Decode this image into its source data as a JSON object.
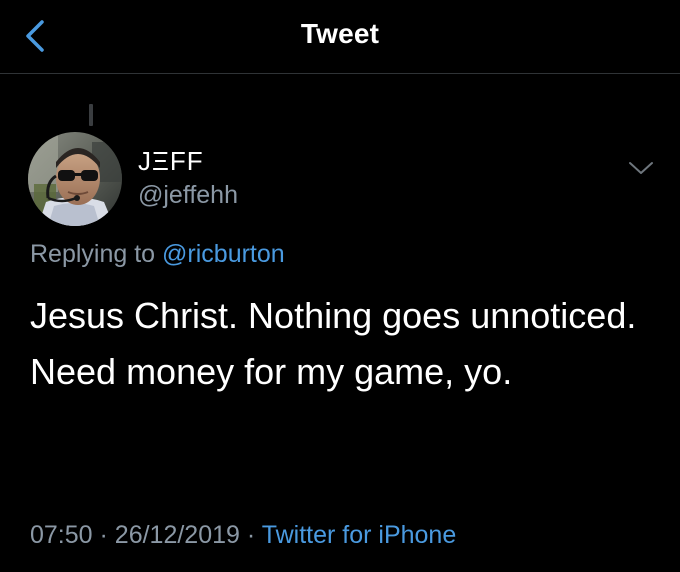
{
  "header": {
    "title": "Tweet",
    "back_icon": "chevron-left-icon",
    "accent_color": "#1d9bf0"
  },
  "tweet": {
    "author": {
      "display_name": "JΞFF",
      "handle": "@jeffehh"
    },
    "replying_prefix": "Replying to",
    "replying_to": "@ricburton",
    "text": "Jesus Christ. Nothing goes unnoticed. Need money for my game, yo.",
    "time": "07:50",
    "separator": "·",
    "date": "26/12/2019",
    "source": "Twitter for iPhone",
    "more_icon": "chevron-down-icon"
  }
}
